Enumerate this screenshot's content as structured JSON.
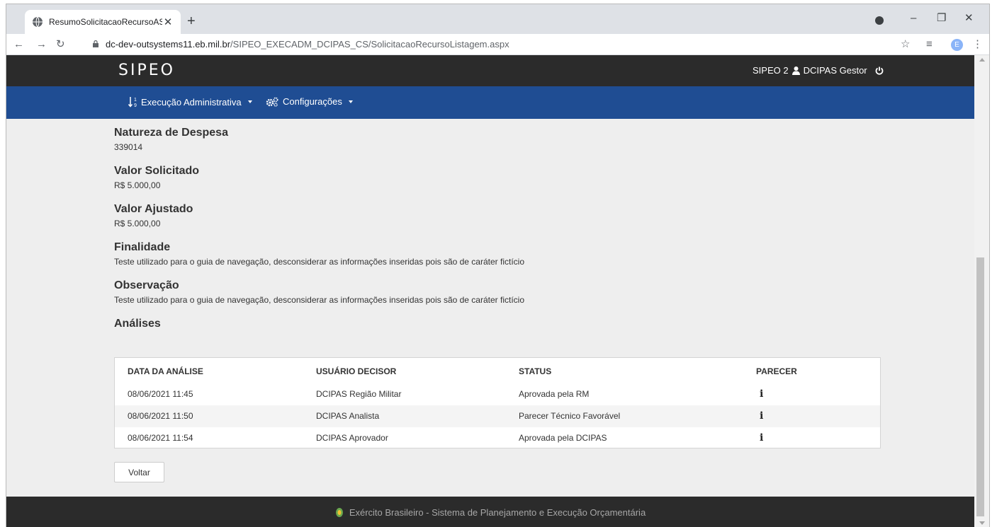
{
  "browser": {
    "tab_title": "ResumoSolicitacaoRecursoAS",
    "tab_close": "✕",
    "new_tab": "+",
    "url_host": "dc-dev-outsystems11.eb.mil.br",
    "url_path": "/SIPEO_EXECADM_DCIPAS_CS/SolicitacaoRecursoListagem.aspx",
    "profile_initial": "E"
  },
  "header": {
    "logo": "SIPEO",
    "system": "SIPEO 2",
    "user": "DCIPAS Gestor"
  },
  "menu": {
    "items": [
      {
        "label": "Execução Administrativa"
      },
      {
        "label": "Configurações"
      }
    ]
  },
  "details": {
    "natureza_label": "Natureza de Despesa",
    "natureza_value": "339014",
    "valor_solicitado_label": "Valor Solicitado",
    "valor_solicitado_value": "R$ 5.000,00",
    "valor_ajustado_label": "Valor Ajustado",
    "valor_ajustado_value": "R$ 5.000,00",
    "finalidade_label": "Finalidade",
    "finalidade_value": "Teste utilizado para o guia de navegação, desconsiderar as informações inseridas pois são de caráter fictício",
    "observacao_label": "Observação",
    "observacao_value": "Teste utilizado para o guia de navegação, desconsiderar as informações inseridas pois são de caráter fictício"
  },
  "analises": {
    "title": "Análises",
    "columns": [
      "DATA DA ANÁLISE",
      "USUÁRIO DECISOR",
      "STATUS",
      "PARECER"
    ],
    "rows": [
      {
        "data": "08/06/2021 11:45",
        "usuario": "DCIPAS Região Militar",
        "status": "Aprovada pela RM"
      },
      {
        "data": "08/06/2021 11:50",
        "usuario": "DCIPAS Analista",
        "status": "Parecer Técnico Favorável"
      },
      {
        "data": "08/06/2021 11:54",
        "usuario": "DCIPAS Aprovador",
        "status": "Aprovada pela DCIPAS"
      }
    ],
    "parecer_icon": "i"
  },
  "actions": {
    "voltar_label": "Voltar"
  },
  "footer": {
    "text": "Exército Brasileiro - Sistema de Planejamento e Execução Orçamentária"
  },
  "colors": {
    "header_dark": "#2b2b2b",
    "menu_blue": "#1f4d93",
    "page_bg": "#eeeeee"
  }
}
